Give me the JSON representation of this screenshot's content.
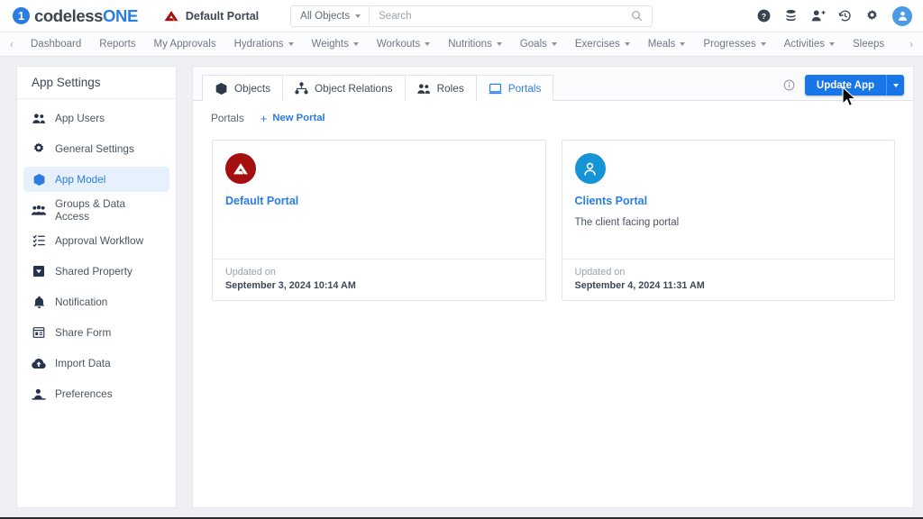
{
  "topbar": {
    "brand_prefix": "codeless",
    "brand_suffix": "ONE",
    "portal_name": "Default Portal",
    "object_filter": "All Objects",
    "search_placeholder": "Search",
    "search_value": "",
    "icons": [
      {
        "name": "help-icon",
        "label": "Help"
      },
      {
        "name": "database-icon",
        "label": "Data"
      },
      {
        "name": "add-user-icon",
        "label": "Add User"
      },
      {
        "name": "history-icon",
        "label": "History"
      },
      {
        "name": "gear-icon",
        "label": "Settings"
      },
      {
        "name": "avatar-icon",
        "label": "Account"
      }
    ]
  },
  "nav": {
    "prev_arrow": "‹",
    "next_arrow": "›",
    "items": [
      {
        "label": "Dashboard",
        "dropdown": false
      },
      {
        "label": "Reports",
        "dropdown": false
      },
      {
        "label": "My Approvals",
        "dropdown": false
      },
      {
        "label": "Hydrations",
        "dropdown": true
      },
      {
        "label": "Weights",
        "dropdown": true
      },
      {
        "label": "Workouts",
        "dropdown": true
      },
      {
        "label": "Nutritions",
        "dropdown": true
      },
      {
        "label": "Goals",
        "dropdown": true
      },
      {
        "label": "Exercises",
        "dropdown": true
      },
      {
        "label": "Meals",
        "dropdown": true
      },
      {
        "label": "Progresses",
        "dropdown": true
      },
      {
        "label": "Activities",
        "dropdown": true
      },
      {
        "label": "Sleeps",
        "dropdown": false
      }
    ]
  },
  "sidebar": {
    "title": "App Settings",
    "items": [
      {
        "label": "App Users",
        "icon": "users-icon",
        "active": false
      },
      {
        "label": "General Settings",
        "icon": "gear-icon",
        "active": false
      },
      {
        "label": "App Model",
        "icon": "cube-icon",
        "active": true
      },
      {
        "label": "Groups & Data Access",
        "icon": "group-access-icon",
        "active": false
      },
      {
        "label": "Approval Workflow",
        "icon": "checklist-icon",
        "active": false
      },
      {
        "label": "Shared Property",
        "icon": "shared-property-icon",
        "active": false
      },
      {
        "label": "Notification",
        "icon": "bell-icon",
        "active": false
      },
      {
        "label": "Share Form",
        "icon": "share-form-icon",
        "active": false
      },
      {
        "label": "Import Data",
        "icon": "cloud-upload-icon",
        "active": false
      },
      {
        "label": "Preferences",
        "icon": "preferences-icon",
        "active": false
      }
    ]
  },
  "main": {
    "tabs": [
      {
        "label": "Objects",
        "icon": "cube-icon",
        "active": false
      },
      {
        "label": "Object Relations",
        "icon": "relations-icon",
        "active": false
      },
      {
        "label": "Roles",
        "icon": "users-icon",
        "active": false
      },
      {
        "label": "Portals",
        "icon": "monitor-icon",
        "active": true
      }
    ],
    "info_tooltip": "Info",
    "update_button": "Update App",
    "breadcrumb": "Portals",
    "new_portal_label": "New Portal",
    "new_portal_plus": "+",
    "updated_label": "Updated on",
    "cards": [
      {
        "title": "Default Portal",
        "description": "",
        "icon": "codeless-logo-icon",
        "icon_color": "#a50f0f",
        "updated_label": "Updated on",
        "updated_value": "September 3, 2024 10:14 AM"
      },
      {
        "title": "Clients Portal",
        "description": "The client facing portal",
        "icon": "person-icon",
        "icon_color": "#1794d6",
        "updated_label": "Updated on",
        "updated_value": "September 4, 2024 11:31 AM"
      }
    ]
  },
  "colors": {
    "accent_blue": "#2a7de1",
    "button_blue": "#1876e8",
    "active_bg": "#e7f0fd",
    "portal_red": "#a50f0f",
    "portal_blue": "#1794d6",
    "page_bg": "#eef0f3"
  }
}
